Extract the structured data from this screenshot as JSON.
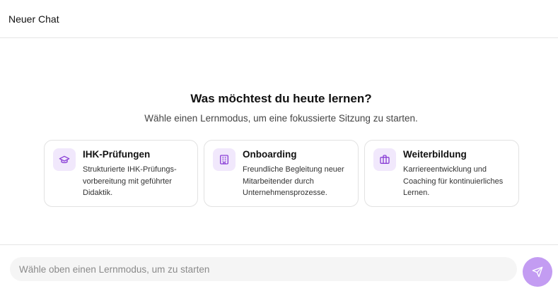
{
  "header": {
    "title": "Neuer Chat"
  },
  "hero": {
    "title": "Was möchtest du heute lernen?",
    "subtitle": "Wähle einen Lernmodus, um eine fokussierte Sitzung zu starten."
  },
  "modes": [
    {
      "icon": "graduation-cap-icon",
      "title": "IHK-Prüfungen",
      "description": "Strukturierte IHK-Prüfungs-vorbereitung mit geführter Didaktik."
    },
    {
      "icon": "building-icon",
      "title": "Onboarding",
      "description": "Freundliche Begleitung neuer Mitarbeitender durch Unternehmensprozesse."
    },
    {
      "icon": "briefcase-icon",
      "title": "Weiterbildung",
      "description": "Karriereentwicklung und Coaching für kontinuierliches Lernen."
    }
  ],
  "composer": {
    "placeholder": "Wähle oben einen Lernmodus, um zu starten",
    "send_icon": "send-icon"
  },
  "colors": {
    "accent": "#c39cf2",
    "icon_bg": "#f1e8fc",
    "icon_stroke": "#8a3fd6",
    "border": "#e2e2e2"
  }
}
